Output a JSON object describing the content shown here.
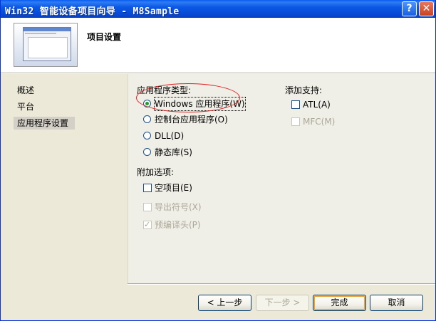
{
  "window": {
    "title": "Win32 智能设备项目向导 - M8Sample",
    "help_icon": "?",
    "close_icon": "✕"
  },
  "header": {
    "title": "项目设置",
    "thumbnail_icon": "window-thumbnail-icon"
  },
  "nav": {
    "items": [
      "概述",
      "平台",
      "应用程序设置"
    ],
    "selected": "应用程序设置"
  },
  "app_type": {
    "label": "应用程序类型:",
    "options": [
      {
        "label": "Windows 应用程序(W)",
        "checked": true
      },
      {
        "label": "控制台应用程序(O)",
        "checked": false
      },
      {
        "label": "DLL(D)",
        "checked": false
      },
      {
        "label": "静态库(S)",
        "checked": false
      }
    ]
  },
  "extra_options": {
    "label": "附加选项:",
    "options": [
      {
        "label": "空项目(E)",
        "checked": false,
        "enabled": true
      },
      {
        "label": "导出符号(X)",
        "checked": false,
        "enabled": false
      },
      {
        "label": "预编译头(P)",
        "checked": true,
        "enabled": false
      }
    ]
  },
  "add_support": {
    "label": "添加支持:",
    "options": [
      {
        "label": "ATL(A)",
        "checked": false,
        "enabled": true
      },
      {
        "label": "MFC(M)",
        "checked": false,
        "enabled": false
      }
    ]
  },
  "buttons": {
    "back": "< 上一步",
    "next": "下一步 >",
    "finish": "完成",
    "cancel": "取消"
  },
  "colors": {
    "titlebar": "#0b58e6",
    "annotation_ellipse": "#e02020"
  }
}
